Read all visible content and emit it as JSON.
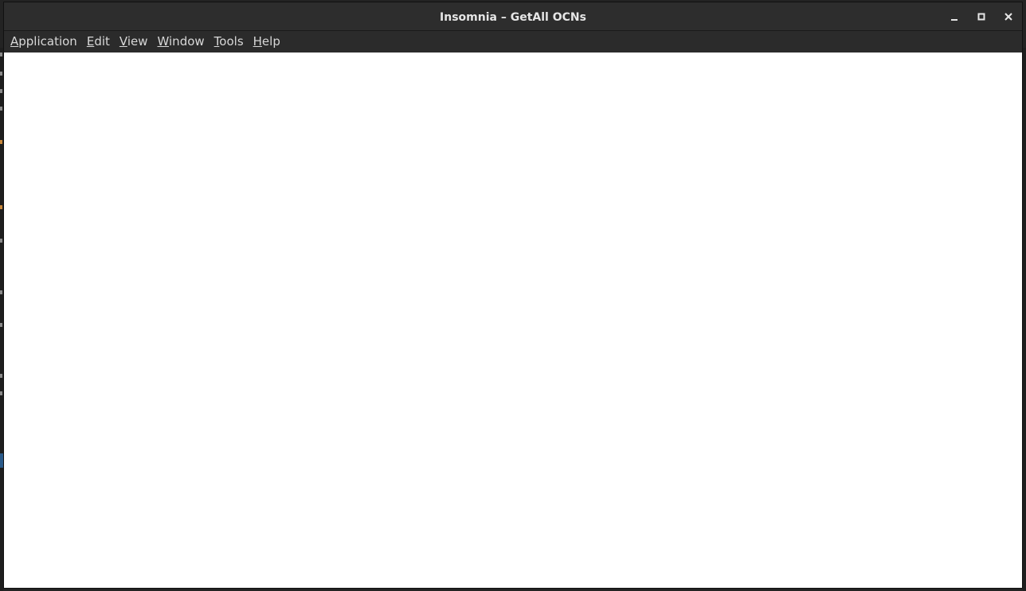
{
  "window": {
    "title": "Insomnia – GetAll OCNs",
    "controls": {
      "minimize_icon": "minimize-icon",
      "maximize_icon": "maximize-icon",
      "close_icon": "close-icon"
    }
  },
  "menubar": {
    "items": [
      {
        "mnemonic": "A",
        "rest": "pplication"
      },
      {
        "mnemonic": "E",
        "rest": "dit"
      },
      {
        "mnemonic": "V",
        "rest": "iew"
      },
      {
        "mnemonic": "W",
        "rest": "indow"
      },
      {
        "mnemonic": "T",
        "rest": "ools"
      },
      {
        "mnemonic": "H",
        "rest": "elp"
      }
    ]
  },
  "colors": {
    "titlebar_bg": "#2d2d2d",
    "content_bg": "#ffffff",
    "text": "#e6e6e6"
  }
}
